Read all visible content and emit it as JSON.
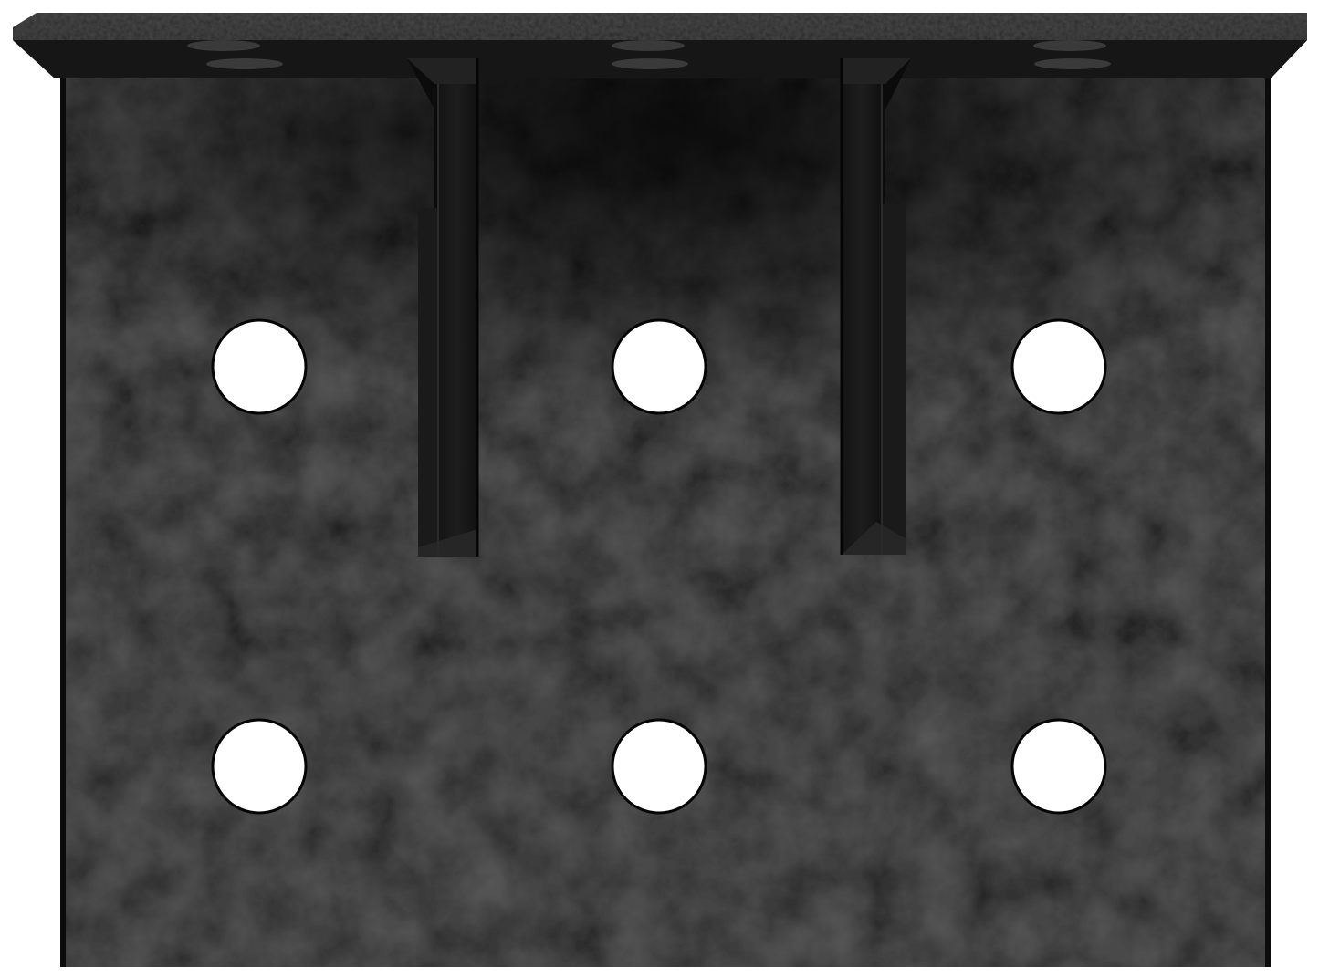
{
  "image": {
    "subject": "black-steel-angle-bracket",
    "background_color": "#ffffff",
    "plate_color": "#1b1b1b",
    "plate_shade_color": "#0e0e0e",
    "flange_color": "#262626",
    "hole_color": "#ffffff",
    "rib_count": 2,
    "front_hole_rows": 2,
    "front_hole_columns": 3,
    "top_flange_hole_pairs": 3
  }
}
